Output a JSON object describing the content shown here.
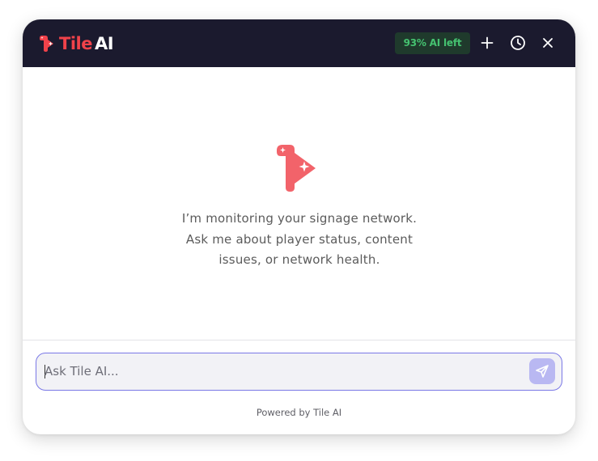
{
  "header": {
    "brand_part1": "Tile",
    "brand_part2": "AI",
    "usage_badge": "93% AI left",
    "new_chat_icon": "plus-icon",
    "history_icon": "clock-icon",
    "close_icon": "close-icon"
  },
  "main": {
    "logo_icon": "tile-ai-sparkle-logo",
    "intro_lines": [
      "I’m monitoring your signage network.",
      "Ask me about player status, content",
      "issues, or network health."
    ]
  },
  "composer": {
    "placeholder": "Ask Tile AI...",
    "value": "",
    "send_icon": "paper-plane-icon"
  },
  "footer": {
    "powered_by": "Powered by Tile AI"
  },
  "colors": {
    "header_bg": "#1b1a2e",
    "brand_red": "#f0424a",
    "badge_bg": "#1f3a2c",
    "badge_text": "#45c270",
    "composer_border": "#7a78e6",
    "send_button": "#b9b8f2",
    "logo_coral": "#f2636a"
  }
}
